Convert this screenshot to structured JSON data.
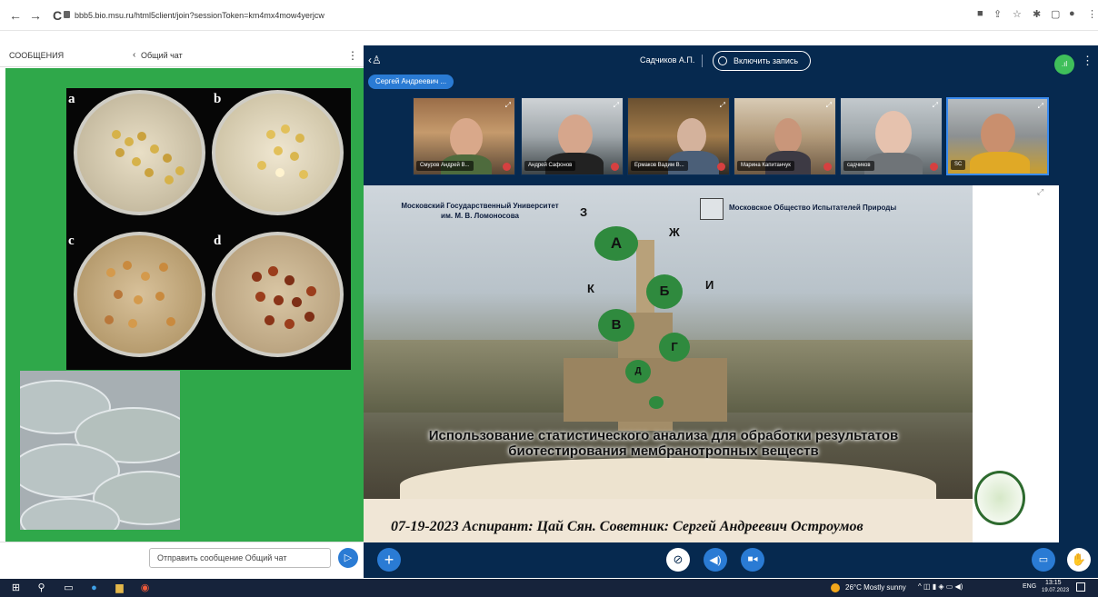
{
  "browser": {
    "back": "←",
    "forward": "→",
    "reload": "C",
    "url": "bbb5.bio.msu.ru/html5client/join?sessionToken=km4mx4mow4yerjcw",
    "icons": [
      "media-icon",
      "share-icon",
      "star-icon",
      "extensions-icon",
      "split-icon",
      "profile-icon",
      "menu-icon"
    ]
  },
  "chat": {
    "title": "СООБЩЕНИЯ",
    "back_label": "Общий чат",
    "menu": "⋮",
    "placeholder": "Отправить сообщение Общий чат",
    "send": "▷",
    "dish_labels": [
      "a",
      "b",
      "c",
      "d"
    ]
  },
  "conference": {
    "presenter_badge": "Сергей Андреевич ...",
    "presenter_name": "Садчиков А.П.",
    "record_label": "Включить запись",
    "participants": [
      {
        "name": "Смуров Андрей В..."
      },
      {
        "name": "Андрей Сафонов"
      },
      {
        "name": "Ермаков Вадим В..."
      },
      {
        "name": "Марина Капитанчук"
      },
      {
        "name": "садчиков"
      },
      {
        "name": "SC"
      }
    ],
    "status_icon": "signal-icon"
  },
  "slide": {
    "uni_left_1": "Московский Государственный Университет",
    "uni_left_2": "им. М. В. Ломоносова",
    "uni_right": "Московское Общество Испытателей Природы",
    "letters_balls": [
      "А",
      "Б",
      "В",
      "Г",
      "Д"
    ],
    "letters_float": [
      "З",
      "Ж",
      "К",
      "И"
    ],
    "title": "Использование статистического анализа для обработки результатов биотестирования мембранотропных веществ",
    "footer": "07-19-2023     Аспирант: Цай Сян. Советник: Сергей Андреевич Остроумов"
  },
  "controls": {
    "add": "+",
    "mic": "mic-off-icon",
    "audio": "audio-icon",
    "camera": "camera-icon",
    "screen": "screen-share-icon",
    "hand": "raise-hand-icon"
  },
  "taskbar": {
    "weather": "26°C  Mostly sunny",
    "lang": "ENG",
    "time": "13:15",
    "date": "19.07.2023"
  }
}
